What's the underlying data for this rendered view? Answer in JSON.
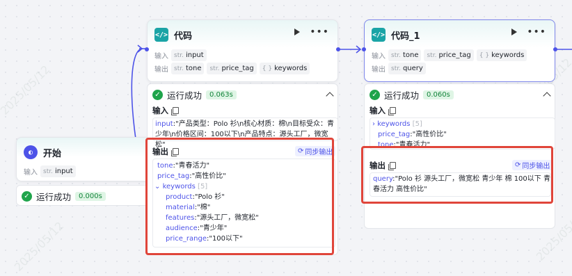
{
  "watermark": "2025/05/12",
  "start_node": {
    "title": "开始",
    "input_label": "输入",
    "input_tag": {
      "type": "str.",
      "name": "input"
    },
    "status": "运行成功",
    "time": "0.000s"
  },
  "code_node": {
    "title": "代码",
    "input_label": "输入",
    "output_label": "输出",
    "inputs": [
      {
        "type": "str.",
        "name": "input"
      }
    ],
    "outputs": [
      {
        "type": "str.",
        "name": "tone"
      },
      {
        "type": "str.",
        "name": "price_tag"
      },
      {
        "type": "{ }",
        "name": "keywords"
      }
    ],
    "status": "运行成功",
    "time": "0.063s",
    "run_input_title": "输入",
    "run_input_key": "input",
    "run_input_text": ":\"产品类型：Polo 衫\\n核心材质：棉\\n目标受众：青少年\\n价格区间：100以下\\n产品特点：源头工厂，微宽松\"",
    "run_output_title": "输出",
    "sync_label": "同步输出",
    "run_outputs": [
      {
        "key": "tone",
        "value": ":\"青春活力\""
      },
      {
        "key": "price_tag",
        "value": ":\"高性价比\""
      }
    ],
    "keywords_key": "keywords",
    "keywords_count": "[5]",
    "keywords": [
      {
        "key": "product",
        "value": ":\"Polo 衫\""
      },
      {
        "key": "material",
        "value": ":\"棉\""
      },
      {
        "key": "features",
        "value": ":\"源头工厂，微宽松\""
      },
      {
        "key": "audience",
        "value": ":\"青少年\""
      },
      {
        "key": "price_range",
        "value": ":\"100以下\""
      }
    ]
  },
  "code1_node": {
    "title": "代码_1",
    "input_label": "输入",
    "output_label": "输出",
    "inputs": [
      {
        "type": "str.",
        "name": "tone"
      },
      {
        "type": "str.",
        "name": "price_tag"
      },
      {
        "type": "{ }",
        "name": "keywords"
      }
    ],
    "outputs": [
      {
        "type": "str.",
        "name": "query"
      }
    ],
    "status": "运行成功",
    "time": "0.060s",
    "run_input_title": "输入",
    "keywords_key": "keywords",
    "keywords_count": "[5]",
    "run_inputs": [
      {
        "key": "price_tag",
        "value": ":\"高性价比\""
      },
      {
        "key": "tone",
        "value": ":\"青春活力\""
      }
    ],
    "run_output_title": "输出",
    "sync_label": "同步输出",
    "query_key": "query",
    "query_value": ":\"Polo 衫 源头工厂，微宽松 青少年 棉 100以下 青春活力 高性价比\""
  },
  "colors": {
    "accent": "#4d53e8",
    "success": "#1fa44b",
    "highlight": "#e0453a",
    "node_icon": "#1aa4a6"
  }
}
